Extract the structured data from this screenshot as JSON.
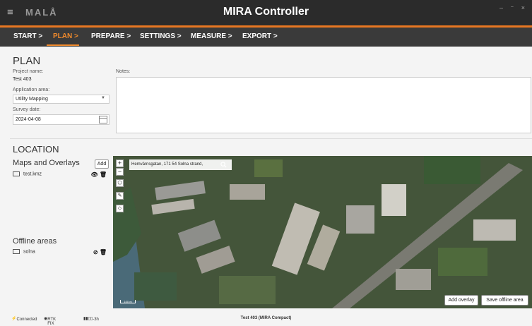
{
  "window": {
    "brand": "MALÅ",
    "title": "MIRA Controller",
    "controls": "– ⁻ ×"
  },
  "nav": {
    "tabs": [
      "START >",
      "PLAN >",
      "PREPARE >",
      "SETTINGS >",
      "MEASURE >",
      "EXPORT >"
    ],
    "active": "PLAN >"
  },
  "plan": {
    "heading": "PLAN",
    "project_label": "Project name:",
    "project_value": "Test 403",
    "application_label": "Application area:",
    "application_value": "Utility Mapping",
    "survey_label": "Survey date:",
    "survey_value": "2024-04-08",
    "notes_label": "Notes:",
    "notes_value": ""
  },
  "location": {
    "heading": "LOCATION",
    "maps_heading": "Maps and Overlays",
    "add_label": "Add",
    "overlays": [
      {
        "name": "test.kmz",
        "icon": "map-icon",
        "actions": [
          "eye-icon",
          "trash-icon"
        ]
      }
    ],
    "offline_heading": "Offline areas",
    "offline": [
      {
        "name": "solna",
        "icon": "map-icon",
        "actions": [
          "eye-off-icon",
          "trash-icon"
        ]
      }
    ]
  },
  "map": {
    "search_text": "Hemvärnsgatan, 171 54 Solna strand,",
    "scale_label": "100 m",
    "add_overlay_label": "Add overlay",
    "save_offline_label": "Save offline area",
    "zoom_in": "+",
    "zoom_out": "−"
  },
  "status": {
    "connected": "Connected",
    "rtk": "RTK FIX",
    "age": "-3h",
    "center": "Test 403 (MIRA Compact)"
  },
  "colors": {
    "accent": "#e87722",
    "nav_bg": "#3a3a3a",
    "title_bg": "#2b2b2b",
    "active_tab": "#f08a2c"
  }
}
